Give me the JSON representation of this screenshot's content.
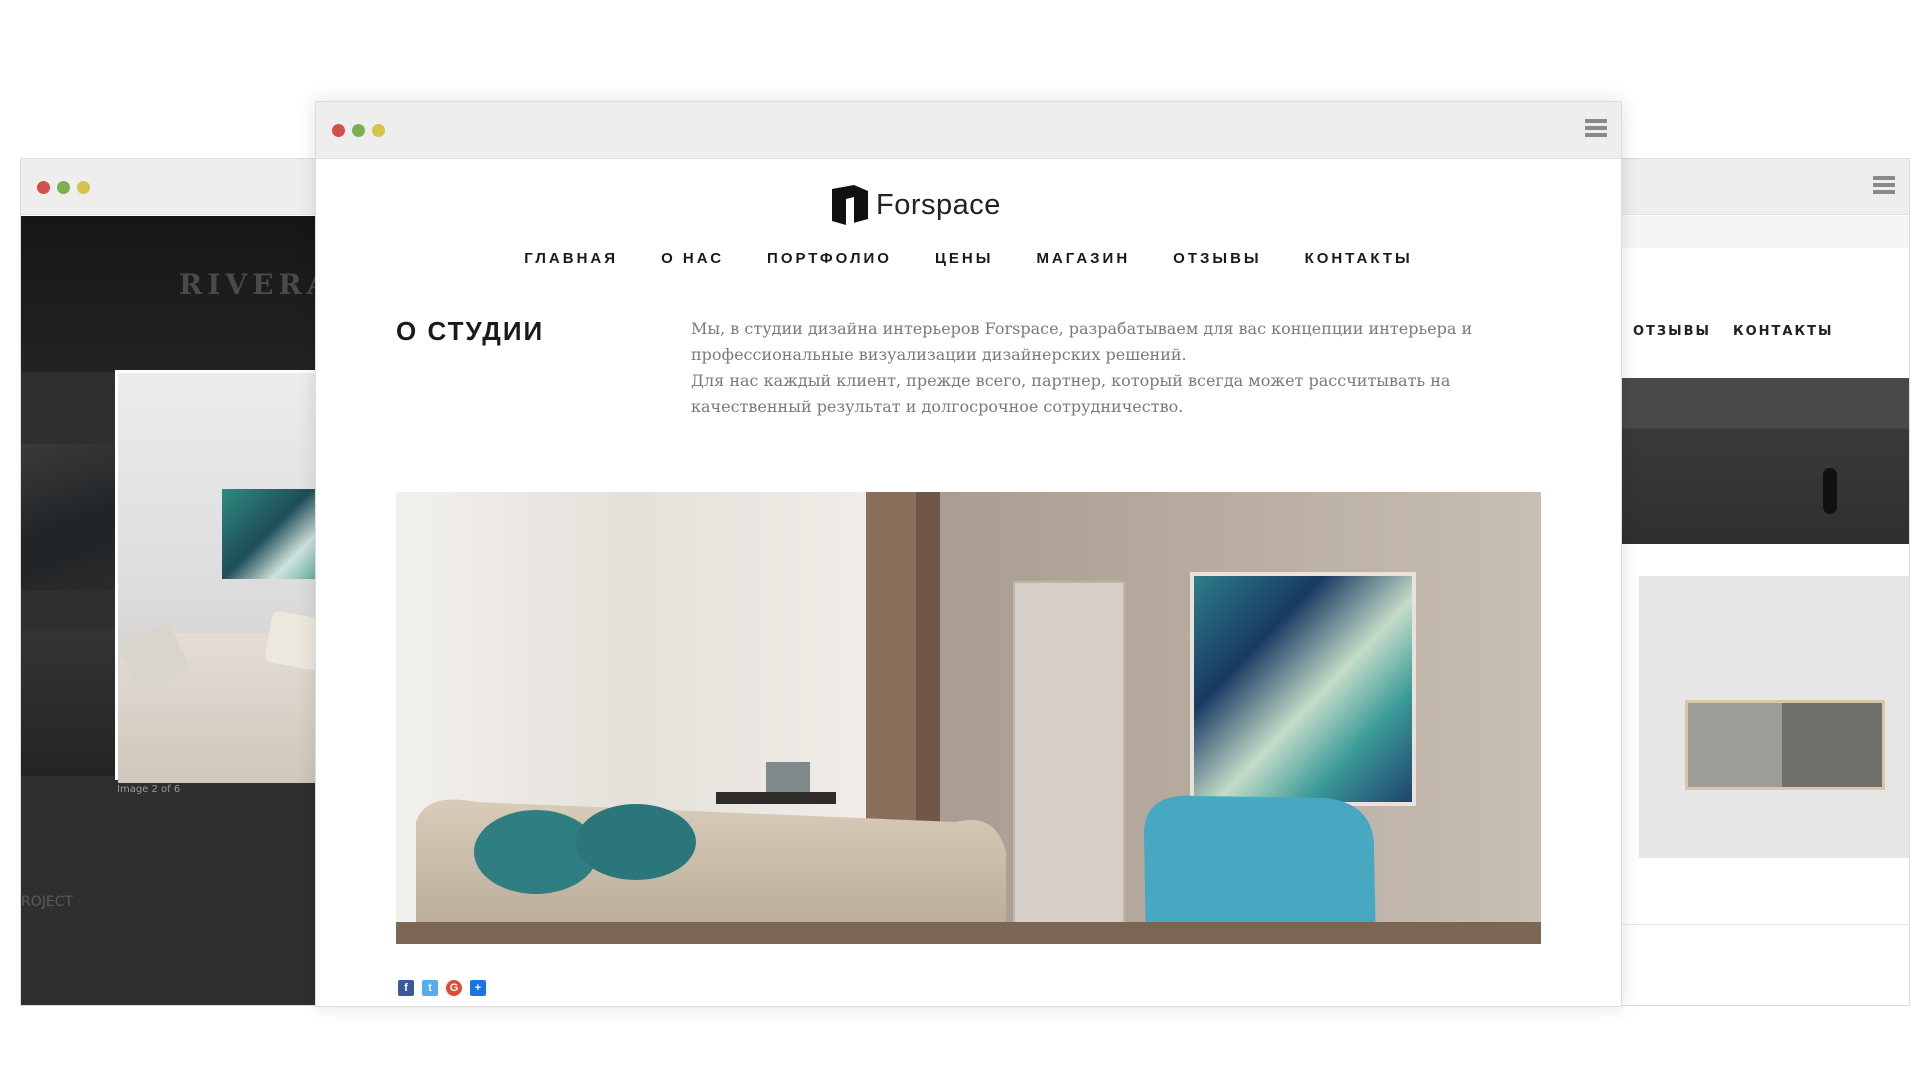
{
  "left_window": {
    "brand_text": "RIVERA",
    "image_caption": "Image 2 of 6",
    "project_label": "ROJECT"
  },
  "right_window": {
    "nav": [
      "ОТЗЫВЫ",
      "КОНТАКТЫ"
    ]
  },
  "main_window": {
    "logo_text": "Forspace",
    "nav": [
      "ГЛАВНАЯ",
      "О НАС",
      "ПОРТФОЛИО",
      "ЦЕНЫ",
      "МАГАЗИН",
      "ОТЗЫВЫ",
      "КОНТАКТЫ"
    ],
    "section_title": "О СТУДИИ",
    "about_paragraphs": [
      "Мы, в студии дизайна интерьеров Forspace, разрабатываем для вас концепции интерьера и профессиональные визуализации дизайнерских решений.",
      "Для нас каждый клиент, прежде всего, партнер, который всегда может рассчитывать на качественный результат и долгосрочное сотрудничество."
    ],
    "share_icons": [
      {
        "name": "facebook-icon",
        "glyph": "f",
        "color": "#3b5998"
      },
      {
        "name": "twitter-icon",
        "glyph": "t",
        "color": "#55acee"
      },
      {
        "name": "google-plus-icon",
        "glyph": "G",
        "color": "#dd4b39"
      },
      {
        "name": "share-plus-icon",
        "glyph": "+",
        "color": "#1a73e8"
      }
    ]
  },
  "colors": {
    "traffic_red": "#d24f4a",
    "traffic_green": "#7bb04f",
    "traffic_yellow": "#d6c34b",
    "titlebar": "#eeeeee"
  }
}
